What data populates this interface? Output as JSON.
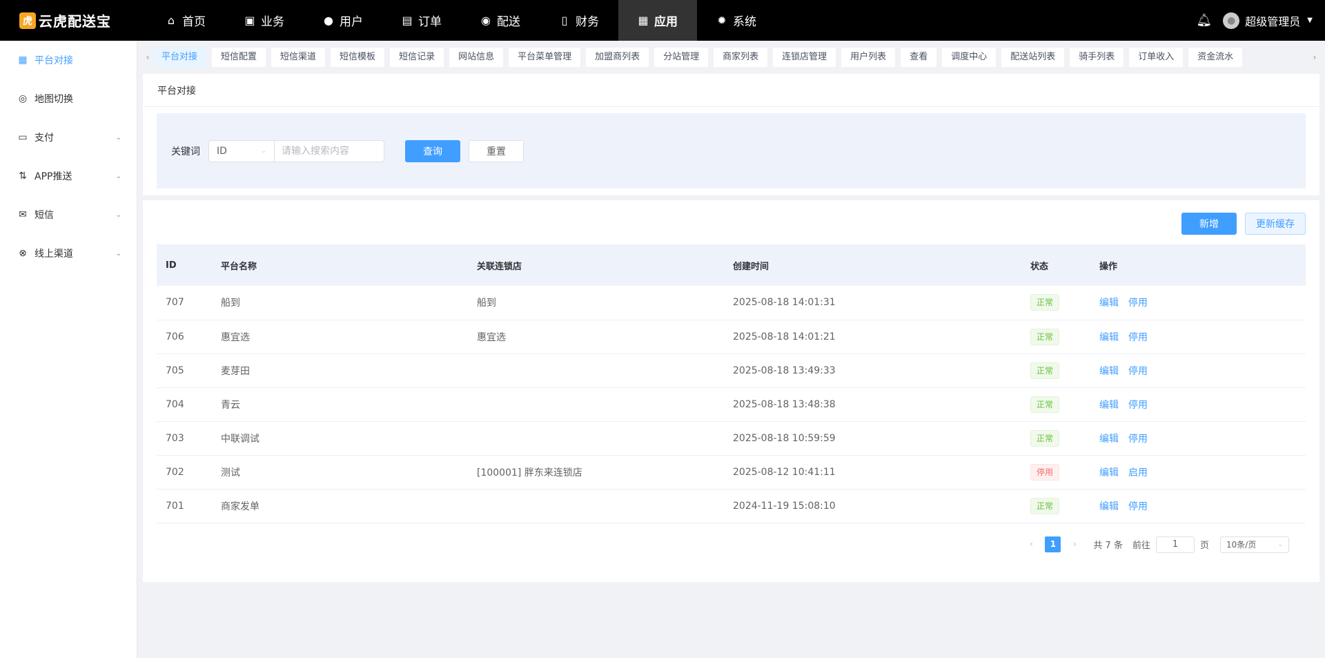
{
  "app": {
    "logo_text": "云虎配送宝"
  },
  "nav": [
    {
      "label": "首页",
      "icon": "home-icon"
    },
    {
      "label": "业务",
      "icon": "briefcase-icon"
    },
    {
      "label": "用户",
      "icon": "user-icon"
    },
    {
      "label": "订单",
      "icon": "clipboard-icon"
    },
    {
      "label": "配送",
      "icon": "location-pin-icon"
    },
    {
      "label": "财务",
      "icon": "document-icon"
    },
    {
      "label": "应用",
      "icon": "grid-icon"
    },
    {
      "label": "系统",
      "icon": "gear-icon"
    }
  ],
  "user": {
    "name": "超级管理员"
  },
  "sidebar": [
    {
      "label": "平台对接",
      "icon": "grid-icon",
      "active": true
    },
    {
      "label": "地图切换",
      "icon": "eye-icon"
    },
    {
      "label": "支付",
      "icon": "box-icon"
    },
    {
      "label": "APP推送",
      "icon": "sort-icon"
    },
    {
      "label": "短信",
      "icon": "mail-icon"
    },
    {
      "label": "线上渠道",
      "icon": "link-icon"
    }
  ],
  "tags": [
    "平台对接",
    "短信配置",
    "短信渠道",
    "短信模板",
    "短信记录",
    "网站信息",
    "平台菜单管理",
    "加盟商列表",
    "分站管理",
    "商家列表",
    "连锁店管理",
    "用户列表",
    "查看",
    "调度中心",
    "配送站列表",
    "骑手列表",
    "订单收入",
    "资金流水"
  ],
  "page": {
    "title": "平台对接"
  },
  "search": {
    "keyword_label": "关键词",
    "field_select": "ID",
    "placeholder": "请输入搜索内容",
    "query_label": "查询",
    "reset_label": "重置"
  },
  "toolbar": {
    "add_label": "新增",
    "refresh_cache_label": "更新缓存"
  },
  "table": {
    "columns": [
      "ID",
      "平台名称",
      "关联连锁店",
      "创建时间",
      "状态",
      "操作"
    ],
    "edit_label": "编辑",
    "rows": [
      {
        "id": "707",
        "name": "船到",
        "store": "船到",
        "created": "2025-08-18 14:01:31",
        "status": "正常",
        "status_type": "ok",
        "toggle": "停用"
      },
      {
        "id": "706",
        "name": "惠宜选",
        "store": "惠宜选",
        "created": "2025-08-18 14:01:21",
        "status": "正常",
        "status_type": "ok",
        "toggle": "停用"
      },
      {
        "id": "705",
        "name": "麦芽田",
        "store": "",
        "created": "2025-08-18 13:49:33",
        "status": "正常",
        "status_type": "ok",
        "toggle": "停用"
      },
      {
        "id": "704",
        "name": "青云",
        "store": "",
        "created": "2025-08-18 13:48:38",
        "status": "正常",
        "status_type": "ok",
        "toggle": "停用"
      },
      {
        "id": "703",
        "name": "中联调试",
        "store": "",
        "created": "2025-08-18 10:59:59",
        "status": "正常",
        "status_type": "ok",
        "toggle": "停用"
      },
      {
        "id": "702",
        "name": "测试",
        "store": "[100001] 胖东来连锁店",
        "created": "2025-08-12 10:41:11",
        "status": "停用",
        "status_type": "off",
        "toggle": "启用"
      },
      {
        "id": "701",
        "name": "商家发单",
        "store": "",
        "created": "2024-11-19 15:08:10",
        "status": "正常",
        "status_type": "ok",
        "toggle": "停用"
      }
    ]
  },
  "pagination": {
    "current_page": "1",
    "total_text": "共 7 条",
    "goto_label": "前往",
    "goto_value": "1",
    "page_unit": "页",
    "page_size": "10条/页"
  },
  "colors": {
    "accent": "#409eff",
    "topbar": "#000000",
    "success": "#67c23a",
    "danger": "#f56c6c"
  }
}
